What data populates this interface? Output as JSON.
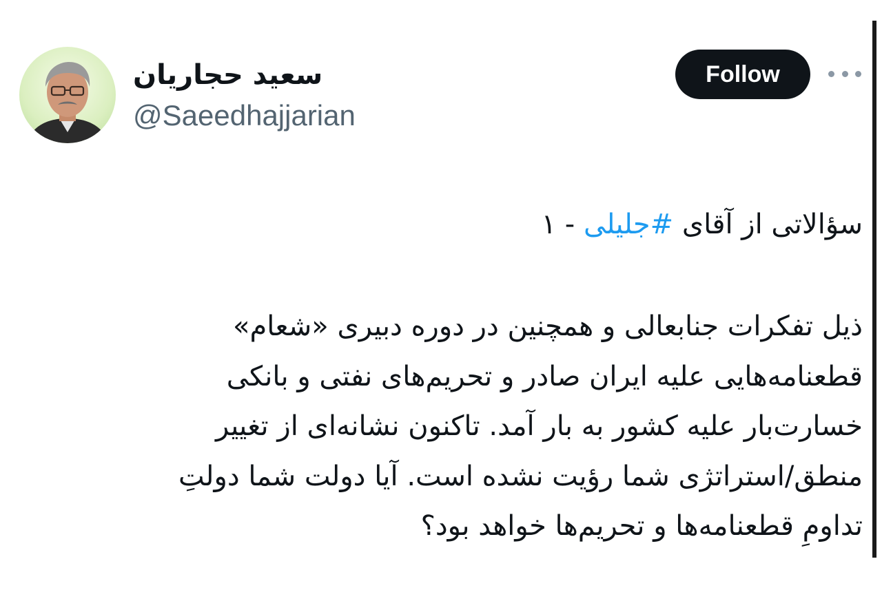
{
  "author": {
    "display_name": "سعید حجاریان",
    "handle": "@Saeedhajjarian",
    "avatar_icon": "profile-photo"
  },
  "actions": {
    "follow_label": "Follow",
    "more_icon": "more-options-icon"
  },
  "tweet": {
    "title_prefix": "سؤالاتی از آقای ",
    "hashtag": "#جلیلی",
    "title_suffix": " - ۱",
    "lines": [
      "ذیل تفکرات جنابعالی و همچنین در دوره دبیری «شعام»",
      "قطعنامه‌هایی علیه ایران صادر و تحریم‌های نفتی و بانکی",
      "خسارت‌بار علیه کشور به بار آمد. تاکنون نشانه‌ای از تغییر",
      "منطق/استراتژی شما رؤیت نشده است. آیا دولت شما دولتِ",
      "تداومِ قطعنامه‌ها و تحریم‌ها خواهد بود؟"
    ]
  },
  "colors": {
    "text": "#0f1419",
    "secondary": "#536471",
    "link": "#1d9bf0",
    "button_bg": "#0f1419",
    "button_text": "#ffffff"
  }
}
